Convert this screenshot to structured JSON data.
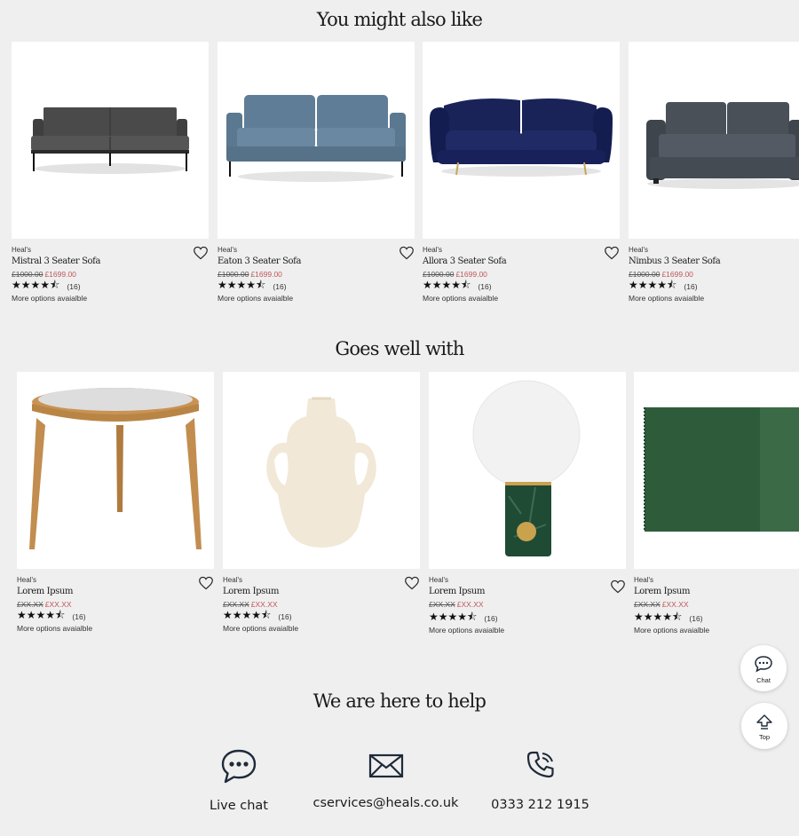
{
  "sections": {
    "recommended_title": "You might also like",
    "pairs_title": "Goes well with",
    "help_title": "We are here to help"
  },
  "recommended": [
    {
      "brand": "Heal's",
      "name": "Mistral 3 Seater Sofa",
      "was": "£1000.00",
      "now": "£1699.00",
      "stars": "★★★★⯪",
      "count": "(16)",
      "more": "More options avaialble"
    },
    {
      "brand": "Heal's",
      "name": "Eaton 3 Seater Sofa",
      "was": "£1000.00",
      "now": "£1699.00",
      "stars": "★★★★⯪",
      "count": "(16)",
      "more": "More options avaialble"
    },
    {
      "brand": "Heal's",
      "name": "Allora 3 Seater Sofa",
      "was": "£1000.00",
      "now": "£1699.00",
      "stars": "★★★★⯪",
      "count": "(16)",
      "more": "More options avaialble"
    },
    {
      "brand": "Heal's",
      "name": "Nimbus 3 Seater Sofa",
      "was": "£1000.00",
      "now": "£1699.00",
      "stars": "★★★★⯪",
      "count": "(16)",
      "more": "More options avaialble"
    }
  ],
  "pairs": [
    {
      "brand": "Heal's",
      "name": "Lorem Ipsum",
      "was": "£XX.XX",
      "now": "£XX.XX",
      "stars": "★★★★⯪",
      "count": "(16)",
      "more": "More options avaialble"
    },
    {
      "brand": "Heal's",
      "name": "Lorem Ipsum",
      "was": "£XX.XX",
      "now": "£XX.XX",
      "stars": "★★★★⯪",
      "count": "(16)",
      "more": "More options avaialble"
    },
    {
      "brand": "Heal's",
      "name": "Lorem Ipsum",
      "was": "£XX.XX",
      "now": "£XX.XX",
      "stars": "★★★★⯪",
      "count": "(16)",
      "more": "More options avaialble"
    },
    {
      "brand": "Heal's",
      "name": "Lorem Ipsum",
      "was": "£XX.XX",
      "now": "£XX.XX",
      "stars": "★★★★⯪",
      "count": "(16)",
      "more": "More options avaialble"
    }
  ],
  "floating": {
    "chat_label": "Chat",
    "top_label": "Top"
  },
  "help": {
    "live_chat": "Live chat",
    "email": "cservices@heals.co.uk",
    "phone": "0333 212 1915"
  },
  "colors": {
    "background": "#efefef",
    "sale_price": "#c0575b",
    "icon_navy": "#1f2a3a"
  }
}
